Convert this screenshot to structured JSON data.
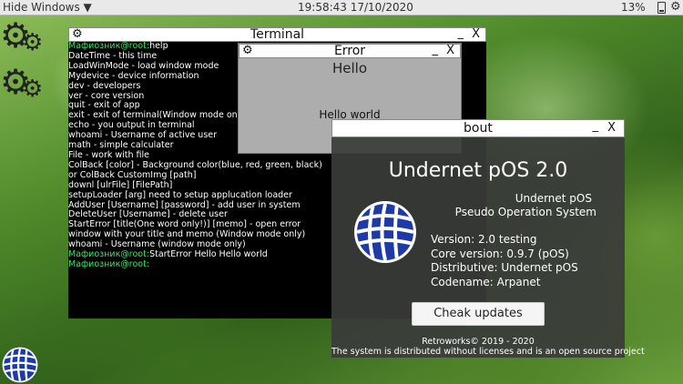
{
  "topbar": {
    "hide_label": "Hide Windows ▼",
    "clock": "19:58:43 17/10/2020",
    "battery": "13%",
    "battery_icon": "battery-icon",
    "settings_icon": "gear-icon"
  },
  "desktop": {
    "icons": [
      "settings-gear-icon",
      "settings-gear-icon",
      "undernet-logo-icon"
    ]
  },
  "terminal": {
    "title": "Terminal",
    "minimize": "_",
    "close": "X",
    "lines": [
      {
        "prompt": "Мафиозник@root:",
        "text": "help"
      },
      {
        "prompt": "",
        "text": "DateTime - this time"
      },
      {
        "prompt": "",
        "text": "LoadWinMode - load window mode"
      },
      {
        "prompt": "",
        "text": "Mydevice - device information"
      },
      {
        "prompt": "",
        "text": "dev - developers"
      },
      {
        "prompt": "",
        "text": "ver - core version"
      },
      {
        "prompt": "",
        "text": "quit - exit of app"
      },
      {
        "prompt": "",
        "text": "exit - exit of terminal(Window mode only)"
      },
      {
        "prompt": "",
        "text": "echo - you output in terminal"
      },
      {
        "prompt": "",
        "text": "whoami - Username of active user"
      },
      {
        "prompt": "",
        "text": "math - simple calculater"
      },
      {
        "prompt": "",
        "text": "File - work with file"
      },
      {
        "prompt": "",
        "text": "ColBack [color] - Background color(blue, red, green, black)"
      },
      {
        "prompt": "",
        "text": "or ColBack CustomImg [path]"
      },
      {
        "prompt": "",
        "text": "downl [ulrFile] [FilePath]"
      },
      {
        "prompt": "",
        "text": "setupLoader [arg] need to setup applucation loader"
      },
      {
        "prompt": "",
        "text": "AddUser [Username] [password] - add user in system"
      },
      {
        "prompt": "",
        "text": "DeleteUser [Username] - delete user"
      },
      {
        "prompt": "",
        "text": "StartError [title(One word only!)] [memo] - open error"
      },
      {
        "prompt": "",
        "text": "window with your title and memo (Window mode only)"
      },
      {
        "prompt": "",
        "text": "whoami - Username (window mode only)"
      },
      {
        "prompt": "Мафиозник@root:",
        "text": "StartError Hello Hello world"
      },
      {
        "prompt": "Мафиозник@root:",
        "text": ""
      }
    ]
  },
  "error_window": {
    "title": "Error",
    "minimize": "_",
    "close": "X",
    "heading": "Hello",
    "message": "Hello world"
  },
  "about_window": {
    "title": "bout",
    "minimize": "_",
    "close": "X",
    "product": "Undernet pOS 2.0",
    "subtitle1": "Undernet pOS",
    "subtitle2": "Pseudo Operation System",
    "version": "Version: 2.0 testing",
    "core_version": "Core version: 0.9.7 (pOS)",
    "distributive": "Distributive: Undernet pOS",
    "codename": "Codename: Arpanet",
    "check_updates": "Cheak updates",
    "copyright": "Retroworks©  2019 - 2020",
    "license": "The system is distributed without licenses and is an open source project"
  }
}
